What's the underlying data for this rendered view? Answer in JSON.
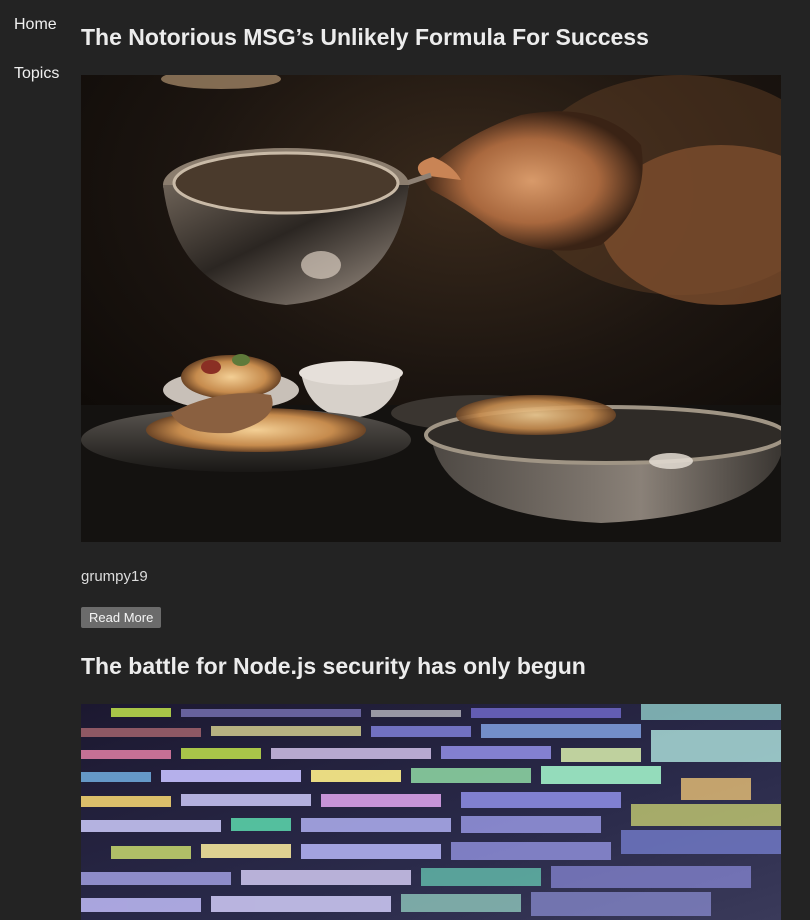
{
  "nav": {
    "home_label": "Home",
    "topics_label": "Topics"
  },
  "posts": [
    {
      "title": "The Notorious MSG’s Unlikely Formula For Success",
      "author": "grumpy19",
      "read_more_label": "Read More"
    },
    {
      "title": "The battle for Node.js security has only begun"
    }
  ],
  "colors": {
    "background": "#232323",
    "button": "#6b6b6b",
    "text": "#ececec"
  }
}
